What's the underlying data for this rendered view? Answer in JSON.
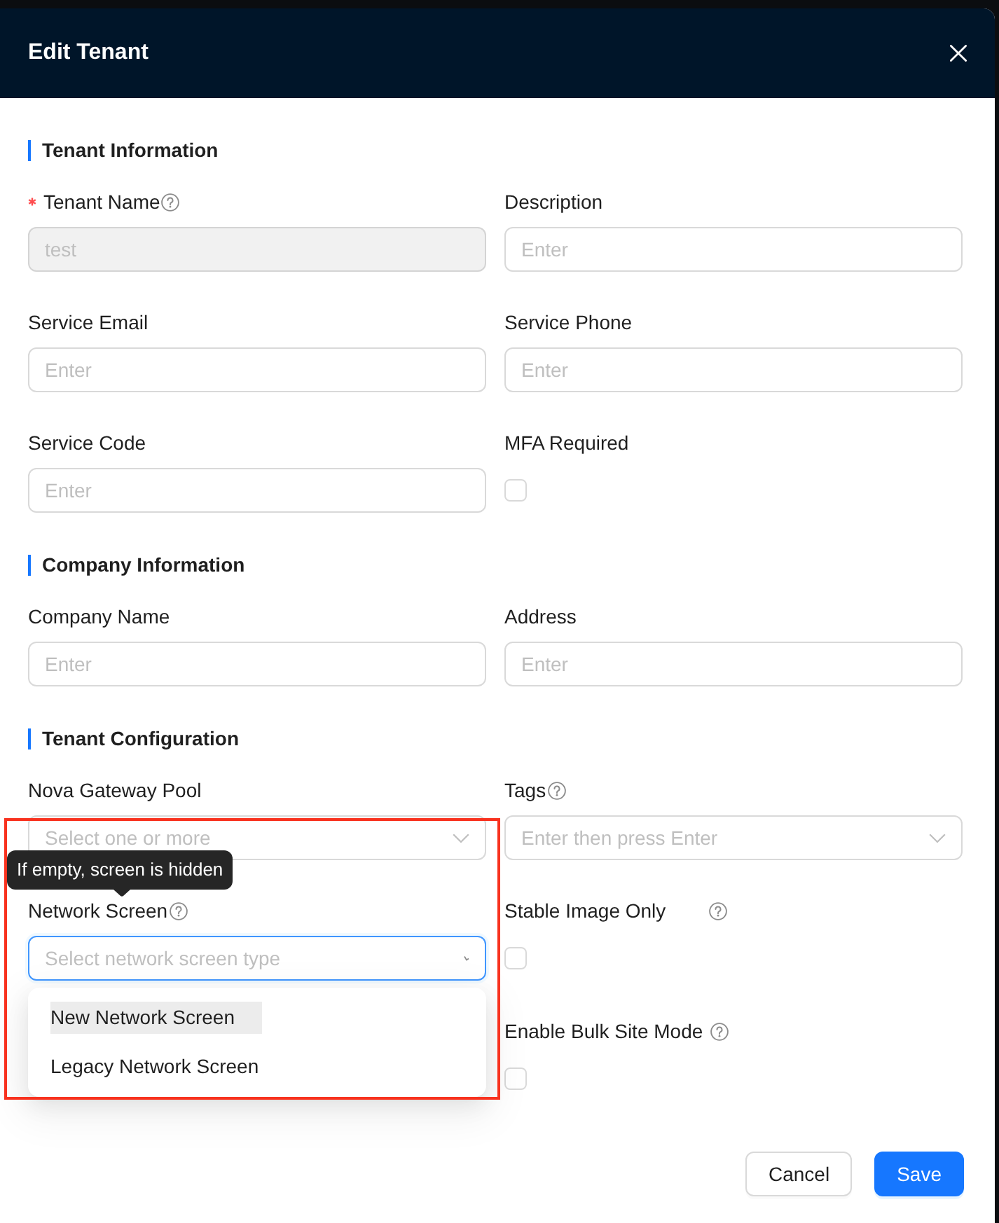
{
  "window": {
    "title": "Edit Tenant"
  },
  "sections": [
    {
      "title": "Tenant Information",
      "columns": [
        [
          {
            "kind": "text",
            "label": "Tenant Name",
            "required": true,
            "help": true,
            "value": "test",
            "disabled": true
          },
          {
            "kind": "text",
            "label": "Service Email",
            "required": false,
            "help": false,
            "placeholder": "Enter",
            "disabled": false
          },
          {
            "kind": "text",
            "label": "Service Code",
            "required": false,
            "help": false,
            "placeholder": "Enter",
            "disabled": false
          }
        ],
        [
          {
            "kind": "text",
            "label": "Description",
            "required": false,
            "help": false,
            "placeholder": "Enter",
            "disabled": false
          },
          {
            "kind": "text",
            "label": "Service Phone",
            "required": false,
            "help": false,
            "placeholder": "Enter",
            "disabled": false
          },
          {
            "kind": "checkbox",
            "label": "MFA Required",
            "required": false,
            "help": false,
            "checked": false
          }
        ]
      ]
    },
    {
      "title": "Company Information",
      "columns": [
        [
          {
            "kind": "text",
            "label": "Company Name",
            "required": false,
            "help": false,
            "placeholder": "Enter",
            "disabled": false
          }
        ],
        [
          {
            "kind": "text",
            "label": "Address",
            "required": false,
            "help": false,
            "placeholder": "Enter",
            "disabled": false
          }
        ]
      ]
    },
    {
      "title": "Tenant Configuration",
      "columns": [
        [
          {
            "kind": "select",
            "label": "Nova Gateway Pool",
            "required": false,
            "help": false,
            "placeholder": "Select one or more",
            "disabled": false,
            "focused": false,
            "open": false
          },
          {
            "kind": "select",
            "label": "Network Screen",
            "required": false,
            "help": true,
            "tooltip": "If empty, screen is hidden",
            "placeholder": "Select network screen type",
            "disabled": false,
            "focused": true,
            "open": true,
            "options": [
              {
                "label": "New Network Screen",
                "active": true
              },
              {
                "label": "Legacy Network Screen",
                "active": false
              }
            ]
          }
        ],
        [
          {
            "kind": "select",
            "label": "Tags",
            "required": false,
            "help": true,
            "placeholder": "Enter then press Enter",
            "disabled": false,
            "focused": false,
            "open": false
          },
          {
            "kind": "checkbox",
            "label": "Stable Image Only",
            "required": false,
            "help": true,
            "checked": false
          },
          {
            "kind": "checkbox",
            "label": "Enable Bulk Site Mode",
            "required": false,
            "help": true,
            "checked": false
          }
        ]
      ]
    }
  ],
  "buttons": [
    {
      "label": "Cancel",
      "kind": "default"
    },
    {
      "label": "Save",
      "kind": "primary"
    }
  ]
}
